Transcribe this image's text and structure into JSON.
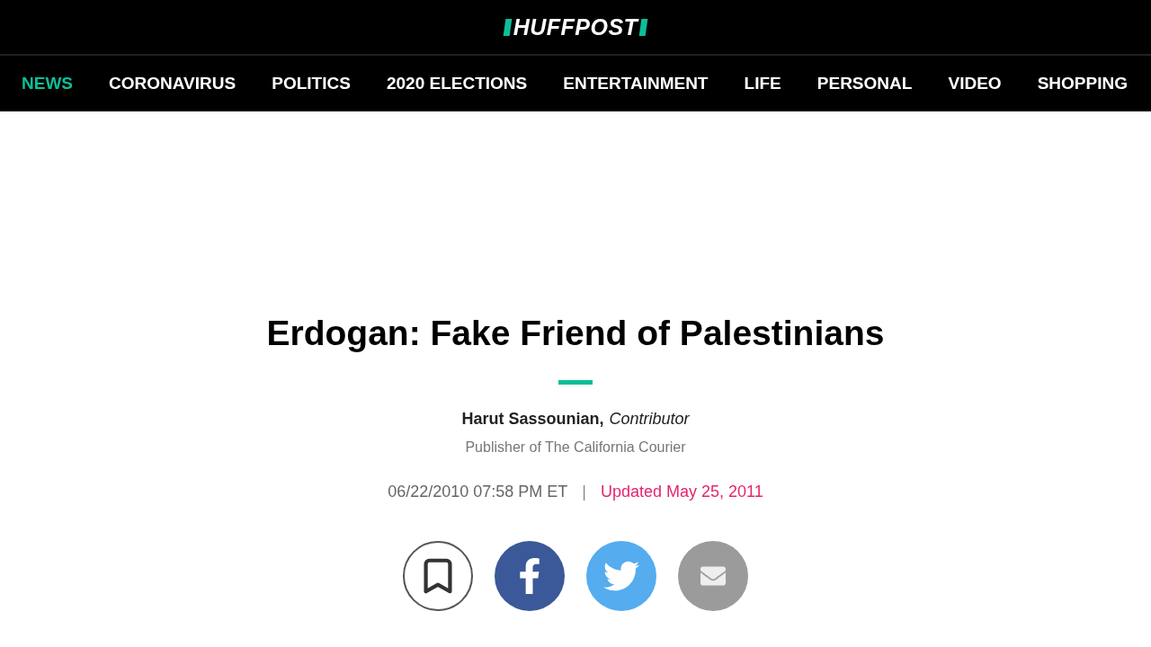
{
  "logo": "HUFFPOST",
  "nav": [
    {
      "label": "NEWS",
      "selected": true
    },
    {
      "label": "CORONAVIRUS",
      "selected": false
    },
    {
      "label": "POLITICS",
      "selected": false
    },
    {
      "label": "2020 ELECTIONS",
      "selected": false
    },
    {
      "label": "ENTERTAINMENT",
      "selected": false
    },
    {
      "label": "LIFE",
      "selected": false
    },
    {
      "label": "PERSONAL",
      "selected": false
    },
    {
      "label": "VIDEO",
      "selected": false
    },
    {
      "label": "SHOPPING",
      "selected": false
    }
  ],
  "article": {
    "headline": "Erdogan: Fake Friend of Palestinians",
    "author": "Harut Sassounian,",
    "role": "Contributor",
    "bio": "Publisher of The California Courier",
    "published": "06/22/2010 07:58 PM ET",
    "separator": "|",
    "updated": "Updated May 25, 2011"
  },
  "share": [
    {
      "kind": "bookmark"
    },
    {
      "kind": "facebook"
    },
    {
      "kind": "twitter"
    },
    {
      "kind": "email"
    }
  ]
}
